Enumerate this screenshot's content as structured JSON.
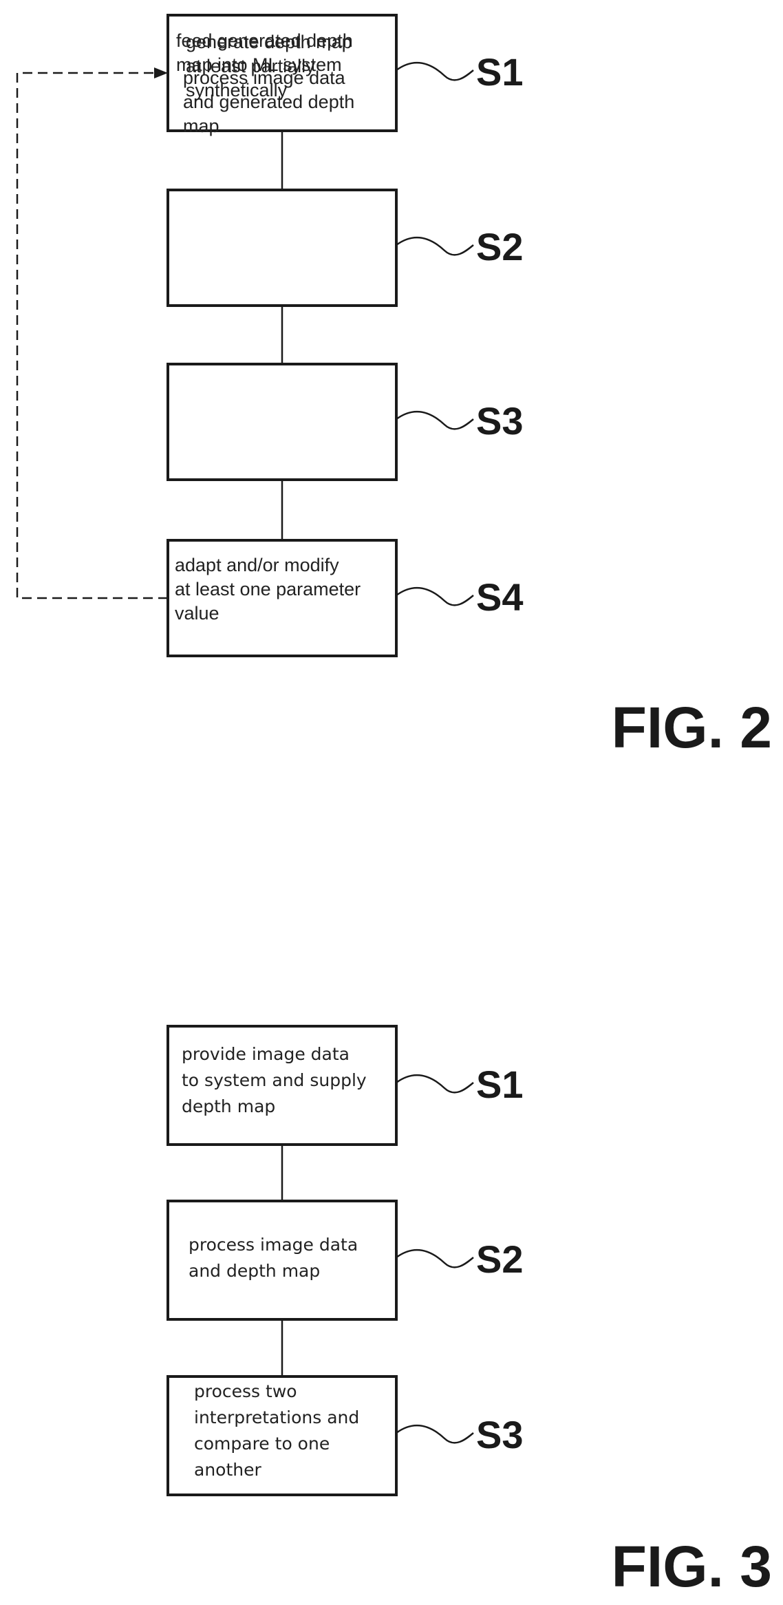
{
  "figures": [
    {
      "caption": "FIG. 2",
      "steps": [
        {
          "label": "S1",
          "lines": [
            "generate depth map",
            "at least partially",
            "synthetically"
          ]
        },
        {
          "label": "S2",
          "lines": [
            "feed generated depth",
            "map into ML system"
          ]
        },
        {
          "label": "S3",
          "lines": [
            "process image data",
            "and generated depth",
            "map"
          ]
        },
        {
          "label": "S4",
          "lines": [
            "adapt and/or modify",
            "at least one parameter",
            "value"
          ]
        }
      ],
      "feedback": {
        "from": "S4",
        "to": "S1",
        "style": "dashed"
      }
    },
    {
      "caption": "FIG. 3",
      "steps": [
        {
          "label": "S1",
          "lines": [
            "provide image data",
            "to system and supply",
            "depth map"
          ]
        },
        {
          "label": "S2",
          "lines": [
            "process image data",
            "and depth map"
          ]
        },
        {
          "label": "S3",
          "lines": [
            "process two",
            "interpretations and",
            "compare to one",
            "another"
          ]
        }
      ]
    }
  ]
}
